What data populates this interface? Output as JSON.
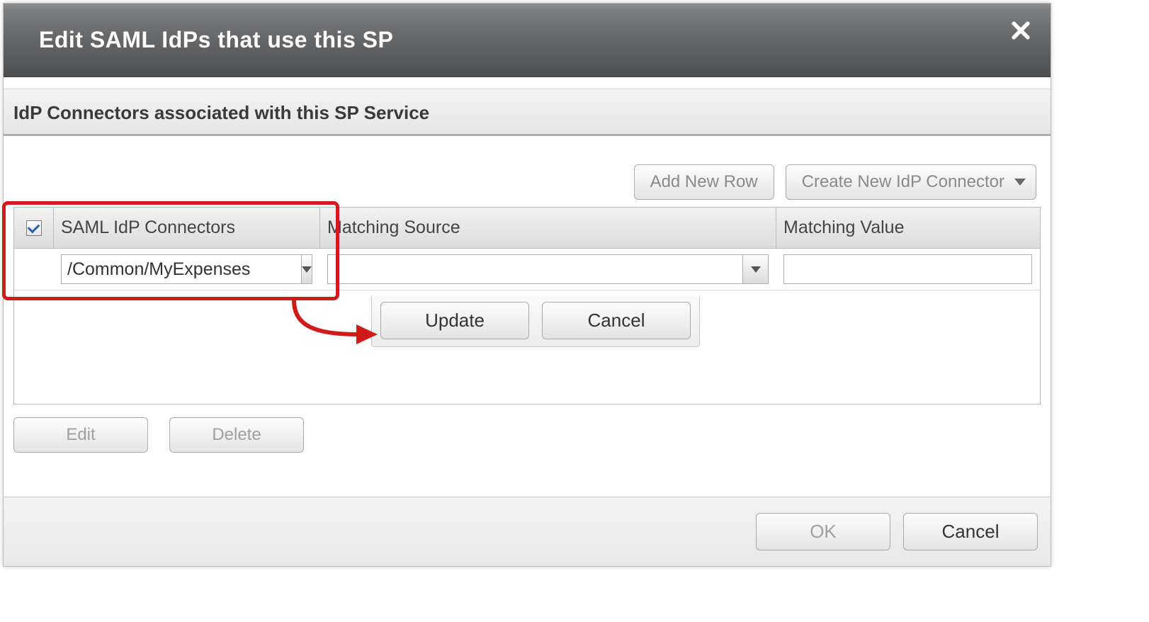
{
  "dialog": {
    "title": "Edit SAML IdPs that use this SP",
    "section_title": "IdP Connectors associated with this SP Service",
    "add_row_label": "Add New Row",
    "create_connector_label": "Create New IdP Connector",
    "columns": {
      "c1": "SAML IdP Connectors",
      "c2": "Matching Source",
      "c3": "Matching Value"
    },
    "row": {
      "checked": true,
      "connector_value": "/Common/MyExpenses",
      "matching_source": "",
      "matching_value": ""
    },
    "row_actions": {
      "update": "Update",
      "cancel": "Cancel"
    },
    "below": {
      "edit": "Edit",
      "delete": "Delete"
    },
    "footer": {
      "ok": "OK",
      "cancel": "Cancel"
    }
  }
}
